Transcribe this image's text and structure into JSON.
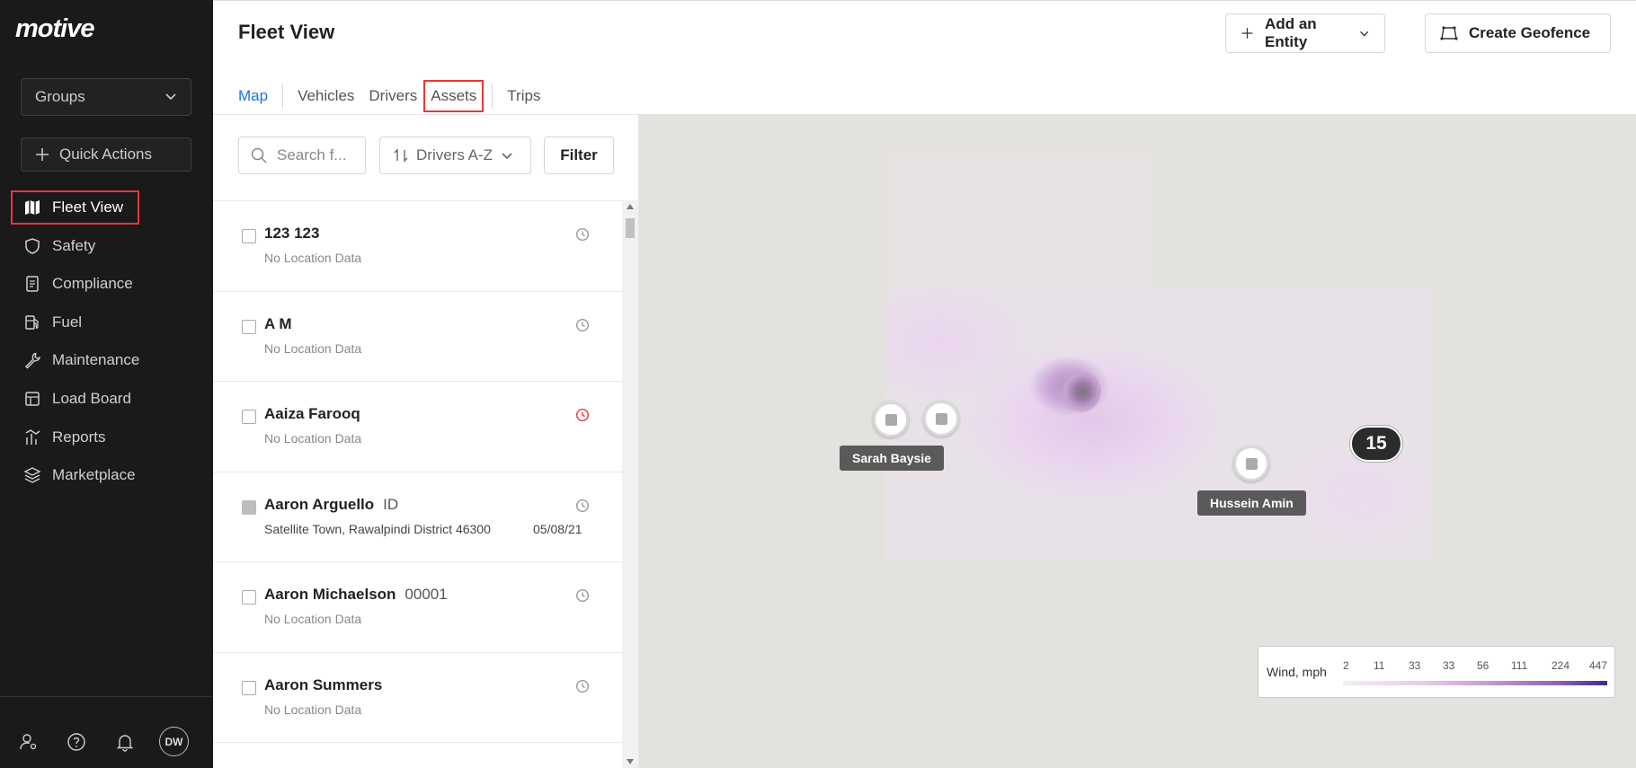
{
  "sidebar": {
    "logo": "motive",
    "groups_label": "Groups",
    "quick_actions_label": "Quick Actions",
    "items": [
      {
        "label": "Fleet View",
        "icon": "map-icon",
        "active": true
      },
      {
        "label": "Safety",
        "icon": "shield-icon"
      },
      {
        "label": "Compliance",
        "icon": "document-icon"
      },
      {
        "label": "Fuel",
        "icon": "fuel-icon"
      },
      {
        "label": "Maintenance",
        "icon": "wrench-icon"
      },
      {
        "label": "Load Board",
        "icon": "board-icon"
      },
      {
        "label": "Reports",
        "icon": "reports-icon"
      },
      {
        "label": "Marketplace",
        "icon": "layers-icon"
      }
    ],
    "avatar_initials": "DW"
  },
  "header": {
    "title": "Fleet View",
    "add_entity_label": "Add an Entity",
    "create_geofence_label": "Create Geofence",
    "tabs": [
      {
        "label": "Map",
        "active": true
      },
      {
        "label": "Vehicles"
      },
      {
        "label": "Drivers"
      },
      {
        "label": "Assets",
        "highlighted": true
      },
      {
        "label": "Trips"
      }
    ]
  },
  "list_panel": {
    "search_placeholder": "Search f...",
    "sort_label": "Drivers A-Z",
    "filter_label": "Filter",
    "rows": [
      {
        "name": "123 123",
        "tag": "",
        "location": "No Location Data",
        "date": "",
        "clock_color": "#999999"
      },
      {
        "name": "A M",
        "tag": "",
        "location": "No Location Data",
        "date": "",
        "clock_color": "#999999"
      },
      {
        "name": "Aaiza Farooq",
        "tag": "",
        "location": "No Location Data",
        "date": "",
        "clock_color": "#e53935"
      },
      {
        "name": "Aaron Arguello",
        "tag": "ID",
        "location": "Satellite Town, Rawalpindi District 46300",
        "date": "05/08/21",
        "clock_color": "#999999"
      },
      {
        "name": "Aaron Michaelson",
        "tag": "00001",
        "location": "No Location Data",
        "date": "",
        "clock_color": "#999999"
      },
      {
        "name": "Aaron Summers",
        "tag": "",
        "location": "No Location Data",
        "date": "",
        "clock_color": "#999999"
      }
    ]
  },
  "map": {
    "markers": [
      {
        "label": "Sarah Baysie"
      },
      {
        "label": "Hussein Amin"
      }
    ],
    "cluster_count": "15",
    "legend": {
      "title": "Wind, mph",
      "ticks": [
        "2",
        "11",
        "33",
        "33",
        "56",
        "111",
        "224",
        "447"
      ]
    }
  },
  "colors": {
    "accent": "#1a73e8",
    "highlight_border": "#e53935",
    "sidebar_bg": "#1a1a1a",
    "map_bg": "#e3e2de"
  }
}
